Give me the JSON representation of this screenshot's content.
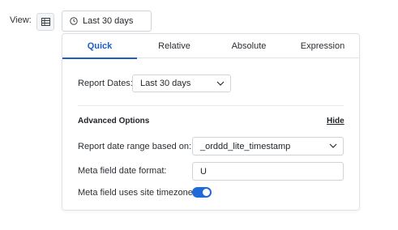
{
  "header": {
    "view_label": "View:",
    "grid_icon": "table-grid-icon",
    "date_button_label": "Last 30 days",
    "clock_icon": "clock-icon"
  },
  "tabs": [
    {
      "label": "Quick",
      "active": true
    },
    {
      "label": "Relative",
      "active": false
    },
    {
      "label": "Absolute",
      "active": false
    },
    {
      "label": "Expression",
      "active": false
    }
  ],
  "quick": {
    "report_dates_label": "Report Dates:",
    "report_dates_value": "Last 30 days"
  },
  "advanced": {
    "title": "Advanced Options",
    "hide_label": "Hide",
    "range_based_on_label": "Report date range based on:",
    "range_based_on_value": "_orddd_lite_timestamp",
    "meta_format_label": "Meta field date format:",
    "meta_format_value": "U",
    "site_timezone_label": "Meta field uses site timezone",
    "site_timezone_enabled": true
  },
  "colors": {
    "accent": "#1e5fc4",
    "toggle_on": "#1e6ad8",
    "border": "#dfe3e7"
  }
}
